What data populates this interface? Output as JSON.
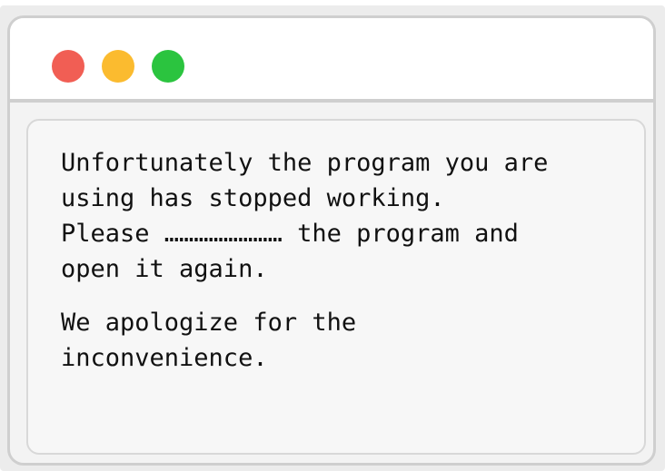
{
  "window": {
    "traffic_lights": {
      "close_color": "#f15e54",
      "minimize_color": "#fbbb2f",
      "maximize_color": "#2bc43f"
    }
  },
  "dialog": {
    "message": "Unfortunately the program you are\nusing has stopped working.\nPlease …………………… the program and\nopen it again.",
    "apology": "We apologize for the\ninconvenience."
  }
}
